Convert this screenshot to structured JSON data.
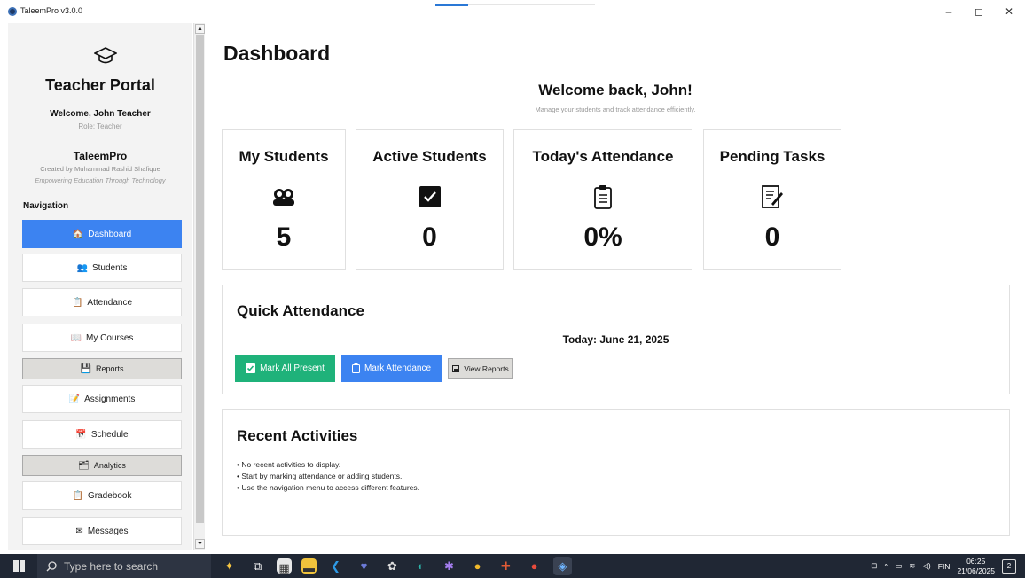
{
  "window": {
    "title": "TaleemPro v3.0.0",
    "minimize": "–",
    "maximize": "◻",
    "close": "✕"
  },
  "sidebar": {
    "portal_title": "Teacher Portal",
    "welcome": "Welcome, John Teacher",
    "role": "Role: Teacher",
    "brand": "TaleemPro",
    "created_by": "Created by Muhammad Rashid Shafique",
    "tagline": "Empowering Education Through Technology",
    "nav_title": "Navigation",
    "items": [
      {
        "label": "Dashboard",
        "icon": "🏠",
        "icon_name": "home-icon"
      },
      {
        "label": "Students",
        "icon": "👥",
        "icon_name": "students-icon"
      },
      {
        "label": "Attendance",
        "icon": "📋",
        "icon_name": "clipboard-icon"
      },
      {
        "label": "My Courses",
        "icon": "📖",
        "icon_name": "book-icon"
      },
      {
        "label": "Reports",
        "icon": "💾",
        "icon_name": "reports-icon"
      },
      {
        "label": "Assignments",
        "icon": "📝",
        "icon_name": "assignment-icon"
      },
      {
        "label": "Schedule",
        "icon": "📅",
        "icon_name": "calendar-icon"
      },
      {
        "label": "Analytics",
        "icon": "🗂",
        "icon_name": "analytics-icon"
      },
      {
        "label": "Gradebook",
        "icon": "📋",
        "icon_name": "gradebook-icon"
      },
      {
        "label": "Messages",
        "icon": "✉",
        "icon_name": "envelope-icon"
      }
    ]
  },
  "main": {
    "page_title": "Dashboard",
    "welcome_back": "Welcome back, John!",
    "welcome_sub": "Manage your students and track attendance efficiently.",
    "stats": [
      {
        "label": "My Students",
        "value": "5"
      },
      {
        "label": "Active Students",
        "value": "0"
      },
      {
        "label": "Today's Attendance",
        "value": "0%"
      },
      {
        "label": "Pending Tasks",
        "value": "0"
      }
    ],
    "quick_attendance": {
      "title": "Quick Attendance",
      "today": "Today: June 21, 2025",
      "mark_all_present": "Mark All Present",
      "mark_attendance": "Mark Attendance",
      "view_reports": "View Reports"
    },
    "recent_activities": {
      "title": "Recent Activities",
      "lines": [
        "• No recent activities to display.",
        "• Start by marking attendance or adding students.",
        "• Use the navigation menu to access different features."
      ]
    }
  },
  "taskbar": {
    "search_placeholder": "Type here to search",
    "language": "FIN",
    "time": "06:25",
    "date": "21/06/2025",
    "notifications": "2"
  },
  "colors": {
    "accent_blue": "#3c83f1",
    "green": "#1fb27a",
    "taskbar": "#202734"
  }
}
